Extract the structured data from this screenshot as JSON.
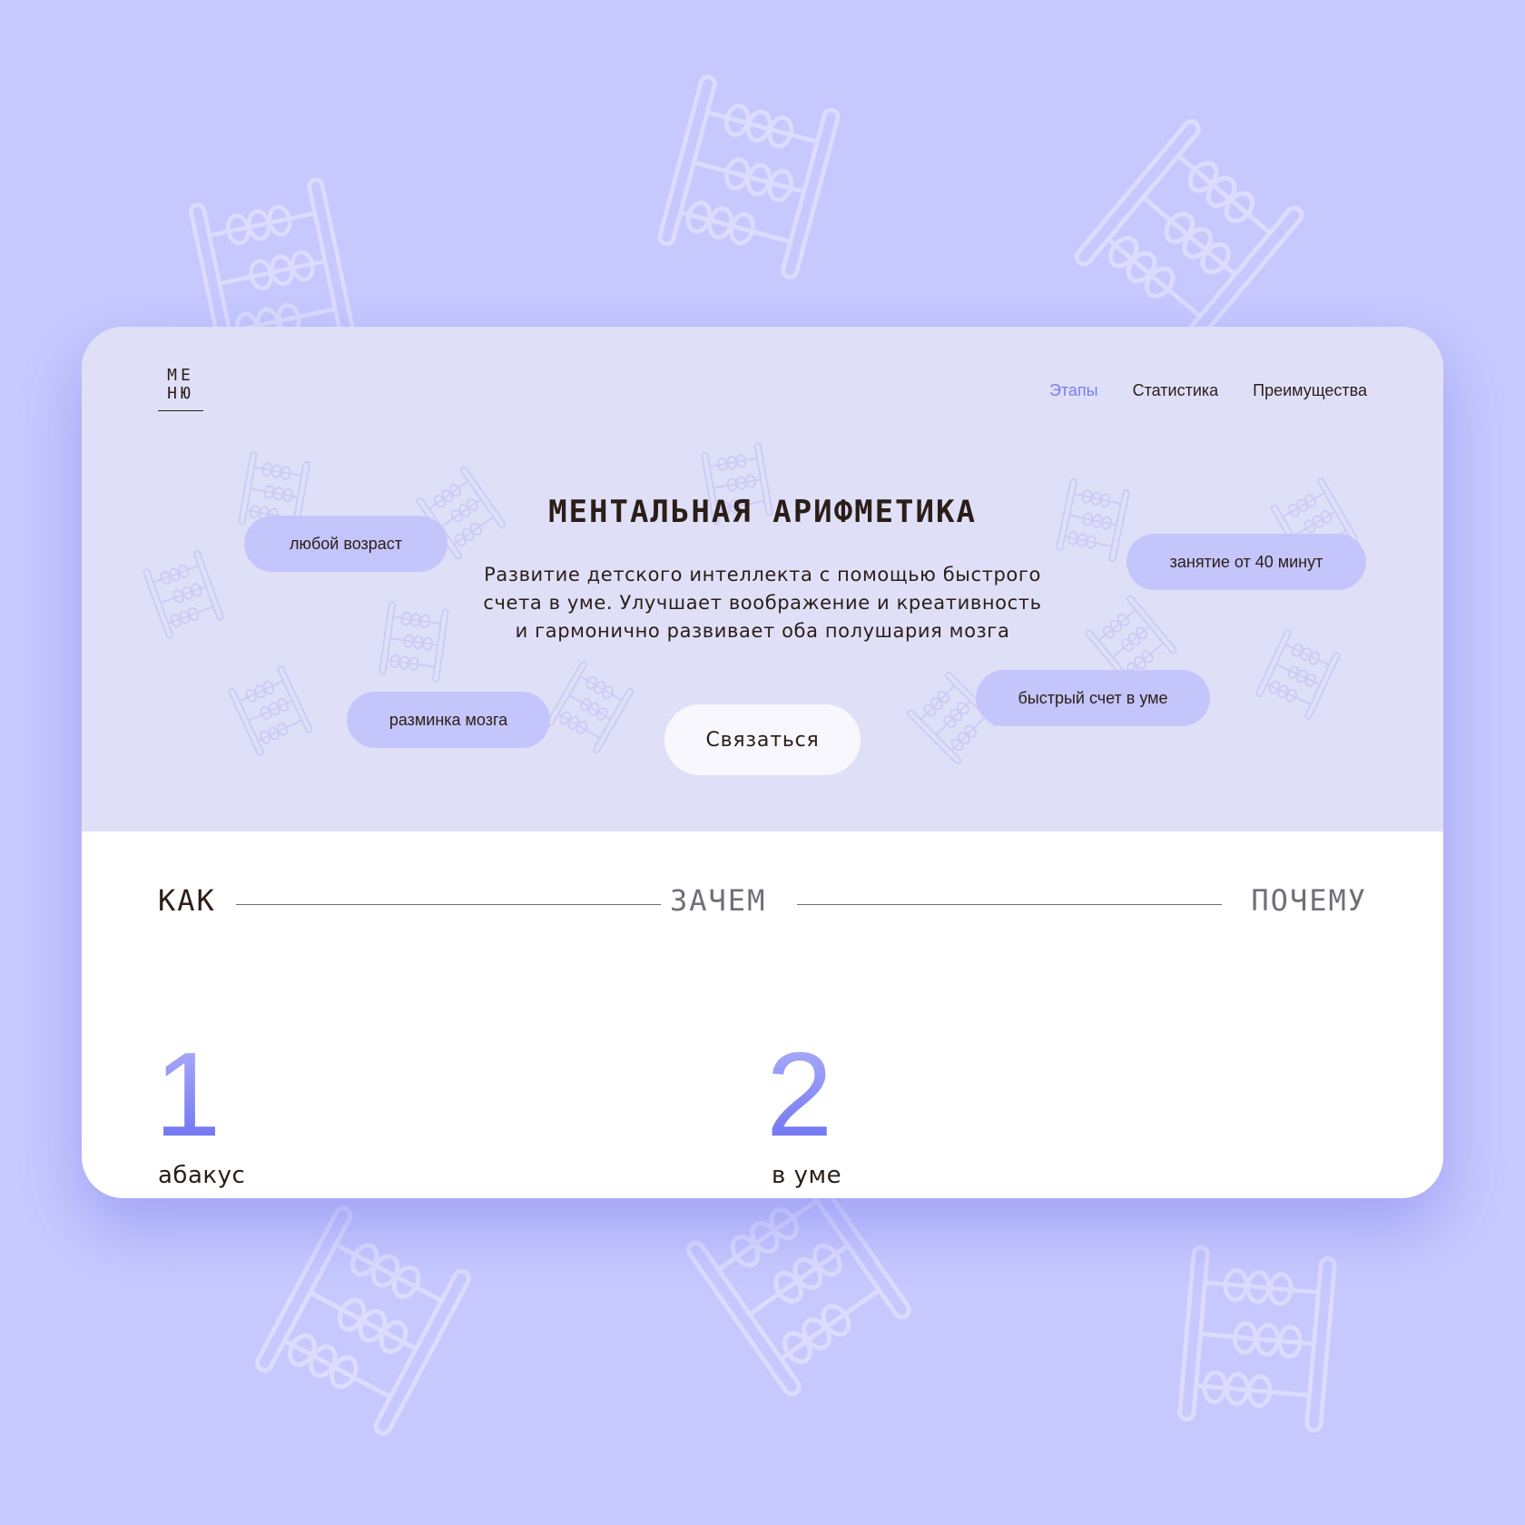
{
  "logo": {
    "line1": "МЕ",
    "line2": "НЮ"
  },
  "nav": {
    "items": [
      {
        "label": "Этапы",
        "active": true
      },
      {
        "label": "Статистика",
        "active": false
      },
      {
        "label": "Преимущества",
        "active": false
      }
    ]
  },
  "hero": {
    "title": "МЕНТАЛЬНАЯ АРИФМЕТИКА",
    "description": "Развитие детского интеллекта с помощью быстрого\nсчета в уме.  Улучшает воображение и креативность\nи гармонично развивает оба полушария мозга",
    "tags": [
      "любой возраст",
      "занятие от 40 минут",
      "разминка мозга",
      "быстрый счет в уме"
    ],
    "cta_label": "Связаться"
  },
  "tabs": [
    "КАК",
    "ЗАЧЕМ",
    "ПОЧЕМУ"
  ],
  "steps": [
    {
      "number": "1",
      "label": "абакус"
    },
    {
      "number": "2",
      "label": "в уме"
    }
  ],
  "colors": {
    "page_background": "#c7c9fe",
    "hero_background": "#dfe0f8",
    "pill": "#c4c5fb",
    "accent": "#7b7cf0",
    "text": "#2b1d17"
  },
  "icons": {
    "decorative": "abacus-icon"
  }
}
